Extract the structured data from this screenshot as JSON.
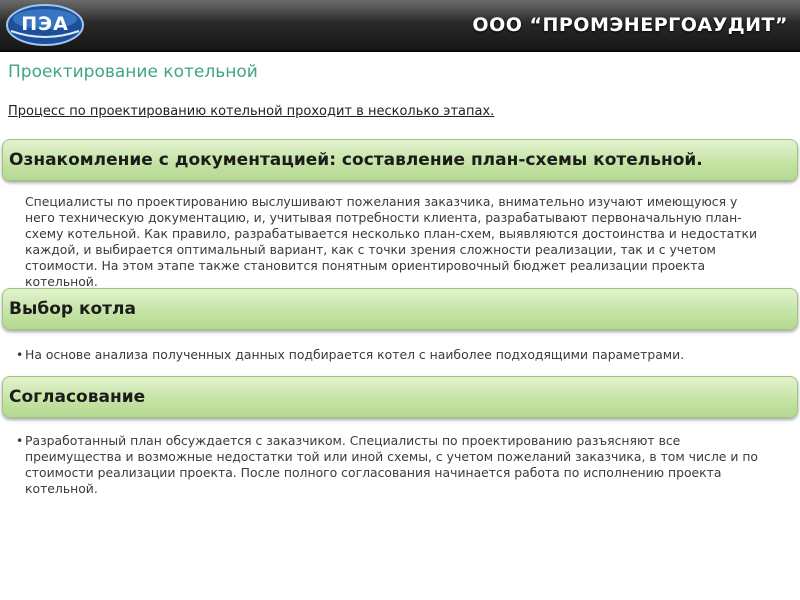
{
  "header": {
    "logo_text": "ПЭА",
    "company": "ООО “ПРОМЭНЕРГОАУДИТ”"
  },
  "page": {
    "title": "Проектирование котельной",
    "subtitle": "Процесс по проектированию котельной проходит в несколько этапах."
  },
  "sections": [
    {
      "title": "Ознакомление с документацией: составление план-схемы котельной.",
      "text": "Специалисты по проектированию выслушивают пожелания заказчика, внимательно изучают имеющуюся у него техническую документацию, и, учитывая потребности клиента, разрабатывают первоначальную план-схему котельной. Как правило, разрабатывается несколько план-схем, выявляются достоинства и недостатки каждой, и выбирается оптимальный вариант, как с точки зрения сложности реализации, так и с учетом стоимости. На этом этапе также становится понятным ориентировочный бюджет реализации проекта котельной."
    },
    {
      "title": "Выбор котла",
      "text": "На основе анализа полученных данных подбирается котел с наиболее подходящими параметрами."
    },
    {
      "title": "Согласование",
      "text": "Разработанный план обсуждается с заказчиком. Специалисты по проектированию разъясняют все преимущества и возможные недостатки той или иной схемы, с учетом пожеланий заказчика, в том числе и по стоимости реализации проекта. После полного согласования начинается работа по исполнению проекта котельной."
    }
  ],
  "colors": {
    "header_bg": "#1e1e1e",
    "title": "#3fa67e",
    "section_bar": "#c6e4a6",
    "logo_blue": "#2b6fc4"
  }
}
